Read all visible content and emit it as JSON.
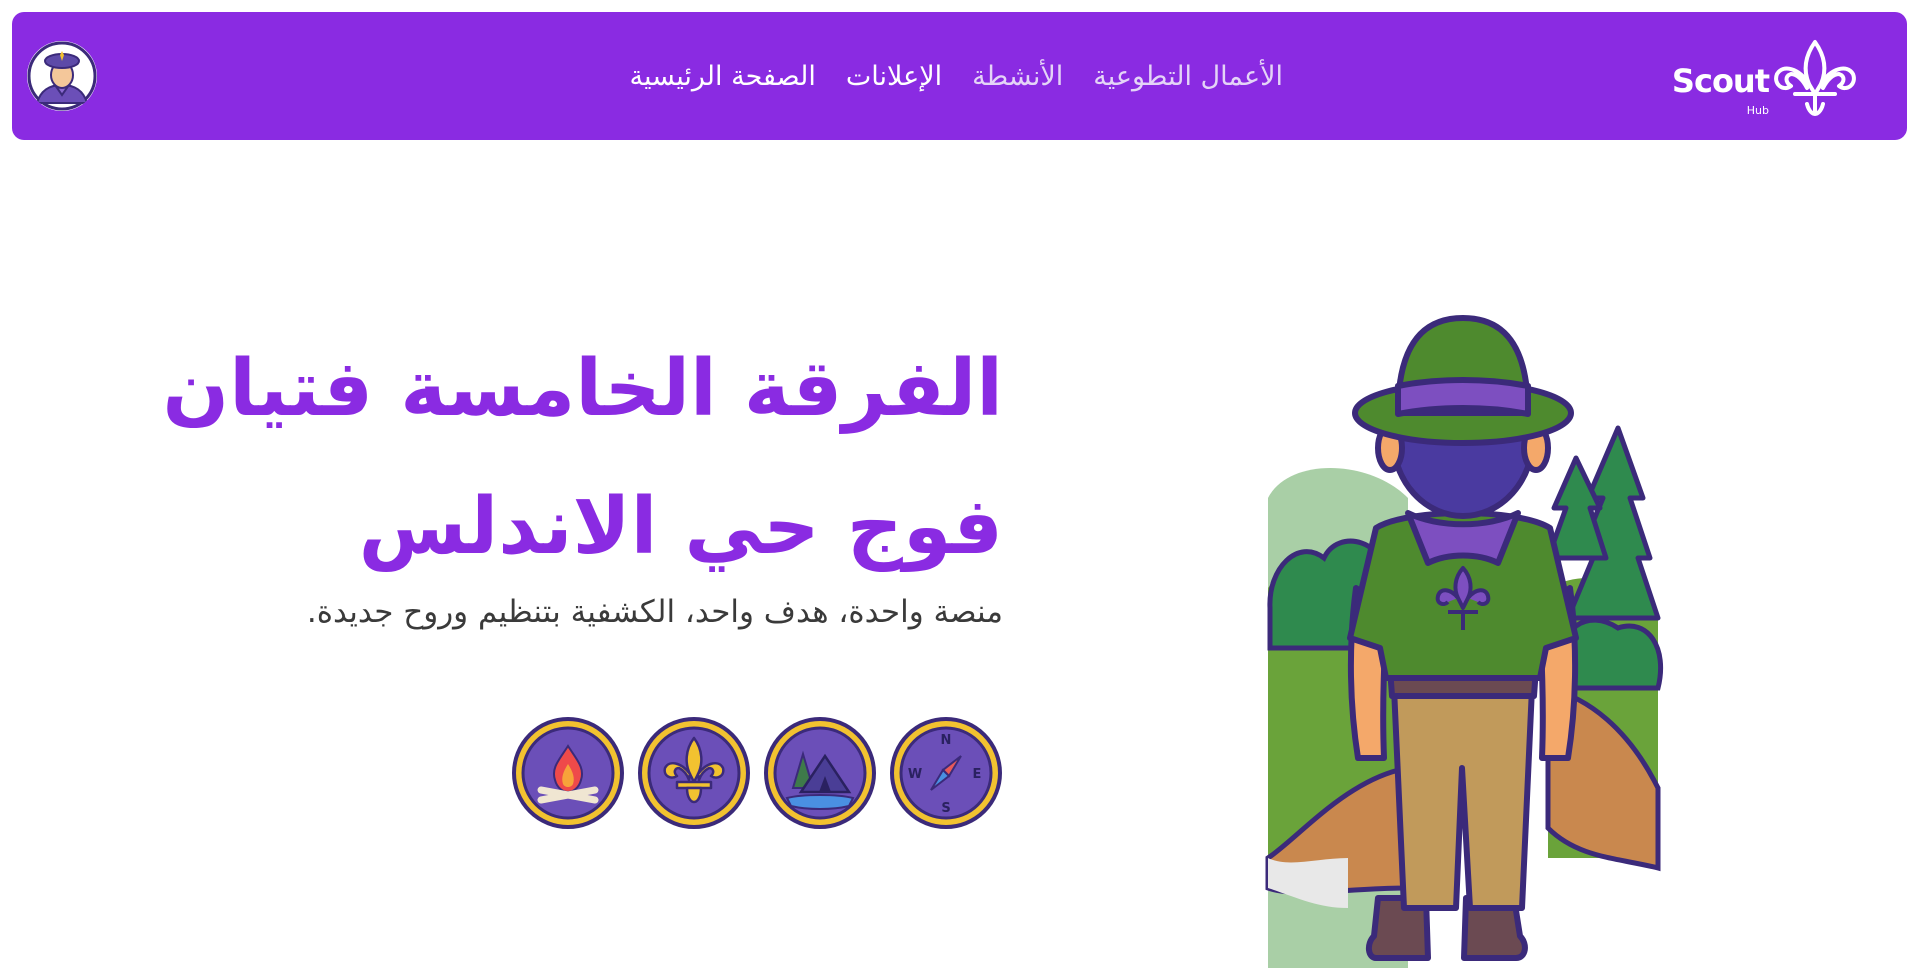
{
  "brand": {
    "name": "Scout",
    "sub": "Hub"
  },
  "nav": {
    "items": [
      {
        "label": "الصفحة الرئيسية"
      },
      {
        "label": "الإعلانات"
      },
      {
        "label": "الأنشطة"
      },
      {
        "label": "الأعمال التطوعية"
      }
    ]
  },
  "hero": {
    "title_line1": "الفرقة الخامسة فتيان",
    "title_line2": "فوج حي الاندلس",
    "subtitle": "منصة واحدة، هدف واحد، الكشفية بتنظيم وروح جديدة."
  },
  "badges": [
    {
      "icon": "compass-icon",
      "letters": [
        "N",
        "E",
        "S",
        "W"
      ]
    },
    {
      "icon": "tent-icon"
    },
    {
      "icon": "fleur-de-lis-icon"
    },
    {
      "icon": "campfire-icon"
    }
  ],
  "colors": {
    "brand_purple": "#8a2be2",
    "badge_purple": "#6b4fb8",
    "badge_ring": "#f2c230",
    "outline": "#3b2a7a",
    "shirt_green": "#4e8a2e",
    "trousers_tan": "#c19a5b"
  }
}
